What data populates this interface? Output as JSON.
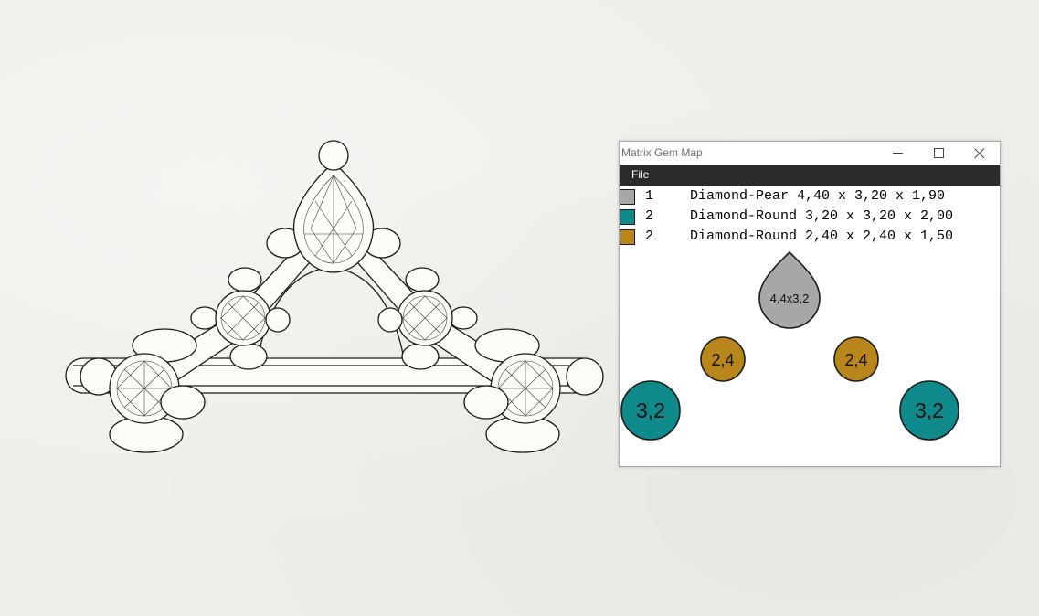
{
  "window": {
    "title": "Matrix Gem Map",
    "controls": [
      "minimize-icon",
      "maximize-icon",
      "close-icon"
    ]
  },
  "menu": {
    "file": "File"
  },
  "legend": [
    {
      "color": "#a7a7a7",
      "qty": "1",
      "desc": "Diamond-Pear 4,40 x 3,20 x 1,90"
    },
    {
      "color": "#0f8a8a",
      "qty": "2",
      "desc": "Diamond-Round 3,20 x 3,20 x 2,00"
    },
    {
      "color": "#b8861b",
      "qty": "2",
      "desc": "Diamond-Round 2,40 x 2,40 x 1,50"
    }
  ],
  "gems": [
    {
      "label": "4,4x3,2",
      "shape": "pear",
      "color": "#a7a7a7"
    },
    {
      "label": "2,4",
      "shape": "round",
      "color": "#b8861b"
    },
    {
      "label": "2,4",
      "shape": "round",
      "color": "#b8861b"
    },
    {
      "label": "3,2",
      "shape": "round",
      "color": "#0f8a8a"
    },
    {
      "label": "3,2",
      "shape": "round",
      "color": "#0f8a8a"
    }
  ],
  "colors": {
    "background": "#eeeeea",
    "menubar": "#2b2b2b",
    "gem_outline": "#1b1b1b"
  }
}
